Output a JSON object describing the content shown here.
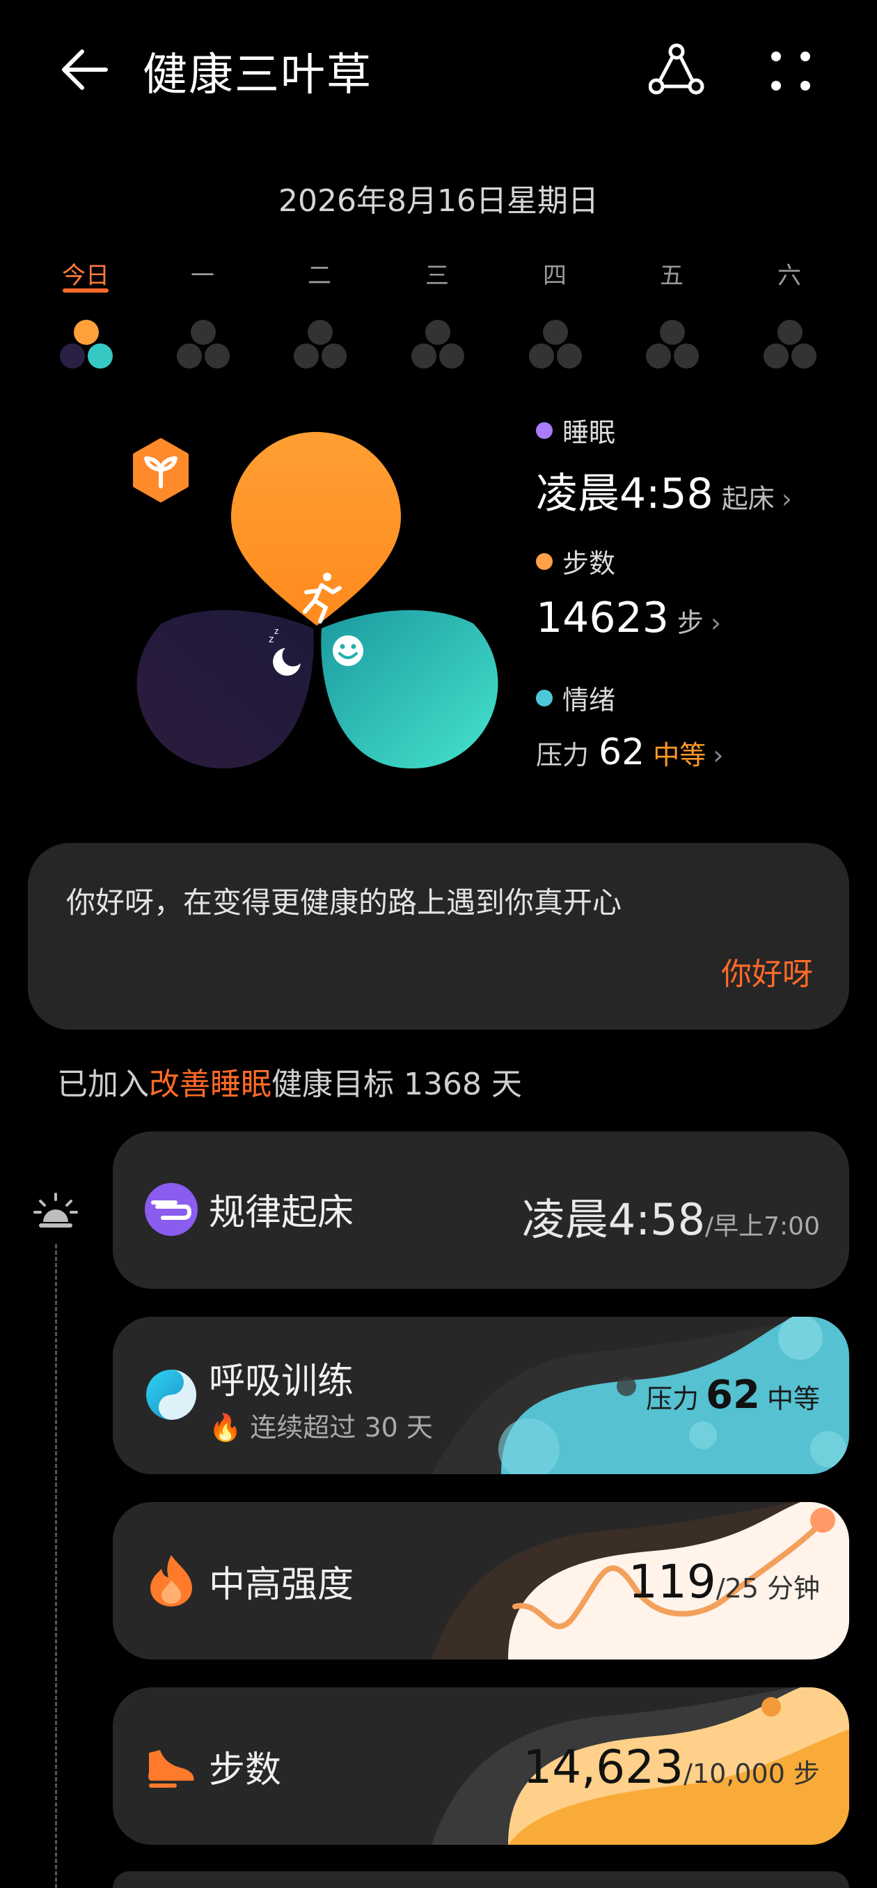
{
  "header": {
    "title": "健康三叶草",
    "back_icon": "arrow-left-icon",
    "share_icon": "share-icon",
    "more_icon": "more-dots-icon"
  },
  "date_title": "2026年8月16日星期日",
  "week": {
    "days": [
      "今日",
      "一",
      "二",
      "三",
      "四",
      "五",
      "六"
    ],
    "selected_index": 0
  },
  "colors": {
    "accent": "#ff6a28",
    "sleep": "#a97cf8",
    "steps": "#ffa04a",
    "mood": "#4cc8d8",
    "card": "#272727"
  },
  "summary": {
    "sleep": {
      "legend": "睡眠",
      "value": "凌晨4:58",
      "unit": "起床"
    },
    "steps": {
      "legend": "步数",
      "value": "14623",
      "unit": "步"
    },
    "mood": {
      "legend": "情绪",
      "prefix": "压力",
      "value": "62",
      "level": "中等"
    }
  },
  "greeting": {
    "text": "你好呀，在变得更健康的路上遇到你真开心",
    "link": "你好呀"
  },
  "goal": {
    "prefix": "已加入",
    "highlight": "改善睡眠",
    "suffix": "健康目标 1368 天"
  },
  "cards": [
    {
      "title": "规律起床",
      "value": "凌晨4:58",
      "target": "/早上7:00",
      "icon": "wake-icon"
    },
    {
      "title": "呼吸训练",
      "subtitle": "连续超过 30 天",
      "prefix": "压力",
      "value": "62",
      "level": "中等",
      "icon": "breath-icon"
    },
    {
      "title": "中高强度",
      "value": "119",
      "target": "/25 分钟",
      "icon": "flame-icon"
    },
    {
      "title": "步数",
      "value": "14,623",
      "target": "/10,000 步",
      "icon": "shoe-icon"
    }
  ]
}
